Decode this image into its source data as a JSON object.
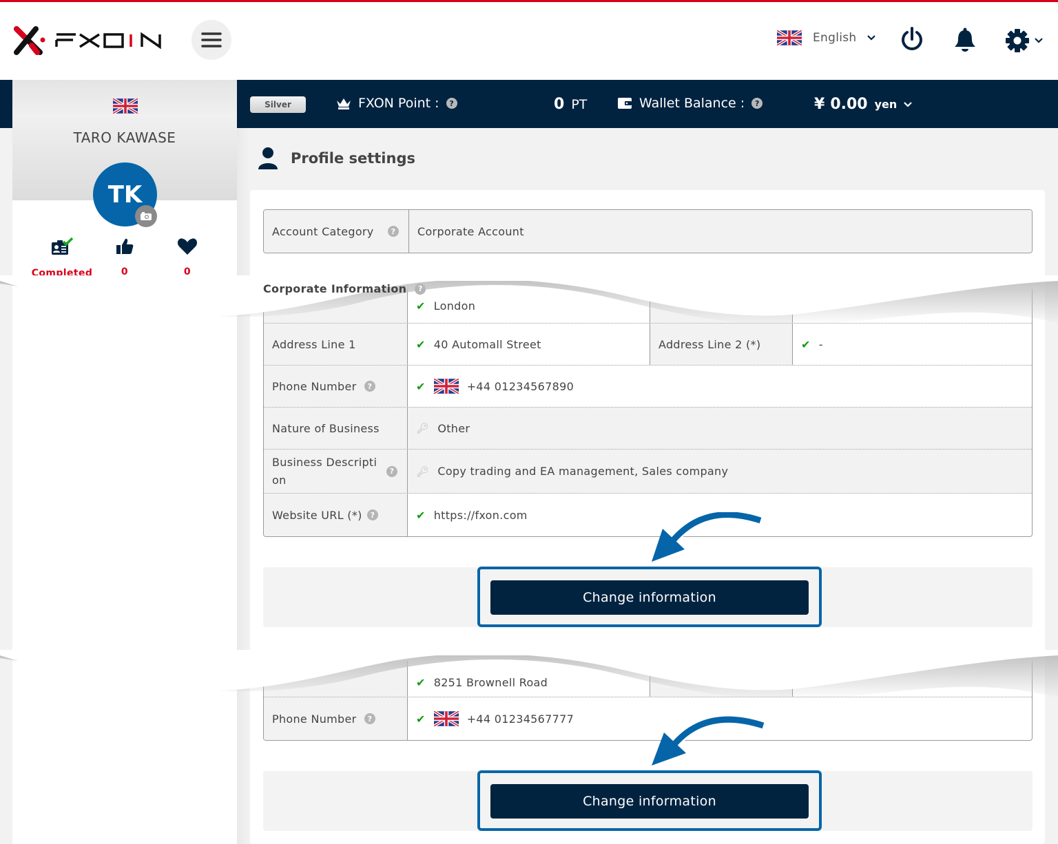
{
  "brand": {
    "name": "FXON",
    "accent": "#d9001b",
    "navy": "#012340",
    "blue": "#0565a8"
  },
  "header": {
    "menu_icon": "hamburger-icon",
    "language": {
      "flag": "uk-flag",
      "label": "English"
    },
    "icons": [
      "power-icon",
      "bell-icon",
      "gear-icon"
    ]
  },
  "navbar": {
    "rank": "Silver",
    "points_label": "FXON Point :",
    "points_value": "0",
    "points_unit": "PT",
    "wallet_label": "Wallet Balance :",
    "wallet_currency": "¥",
    "wallet_value": "0.00",
    "wallet_unit": "yen"
  },
  "sidebar": {
    "flag": "uk-flag",
    "username": "TARO KAWASE",
    "initials": "TK",
    "stats": [
      {
        "icon": "id-card-check-icon",
        "value": "Completed"
      },
      {
        "icon": "thumbs-up-icon",
        "value": "0"
      },
      {
        "icon": "heart-icon",
        "value": "0"
      }
    ]
  },
  "page": {
    "title": "Profile settings"
  },
  "account": {
    "label": "Account Category",
    "value": "Corporate Account"
  },
  "corporate": {
    "section_label": "Corporate Information",
    "city": "London",
    "address1_label": "Address Line 1",
    "address1_value": "40 Automall Street",
    "address2_label": "Address Line 2 (*)",
    "address2_value": "-",
    "phone_label": "Phone Number",
    "phone_value": "+44 01234567890",
    "nature_label": "Nature of Business",
    "nature_value": "Other",
    "desc_label_1": "Business Descripti",
    "desc_label_2": "on",
    "desc_value": "Copy trading and EA management, Sales company",
    "url_label": "Website URL (*)",
    "url_value": "https://fxon.com",
    "button": "Change information"
  },
  "representative": {
    "address": "8251 Brownell Road",
    "phone_label": "Phone Number",
    "phone_value": "+44 01234567777",
    "button": "Change information"
  }
}
